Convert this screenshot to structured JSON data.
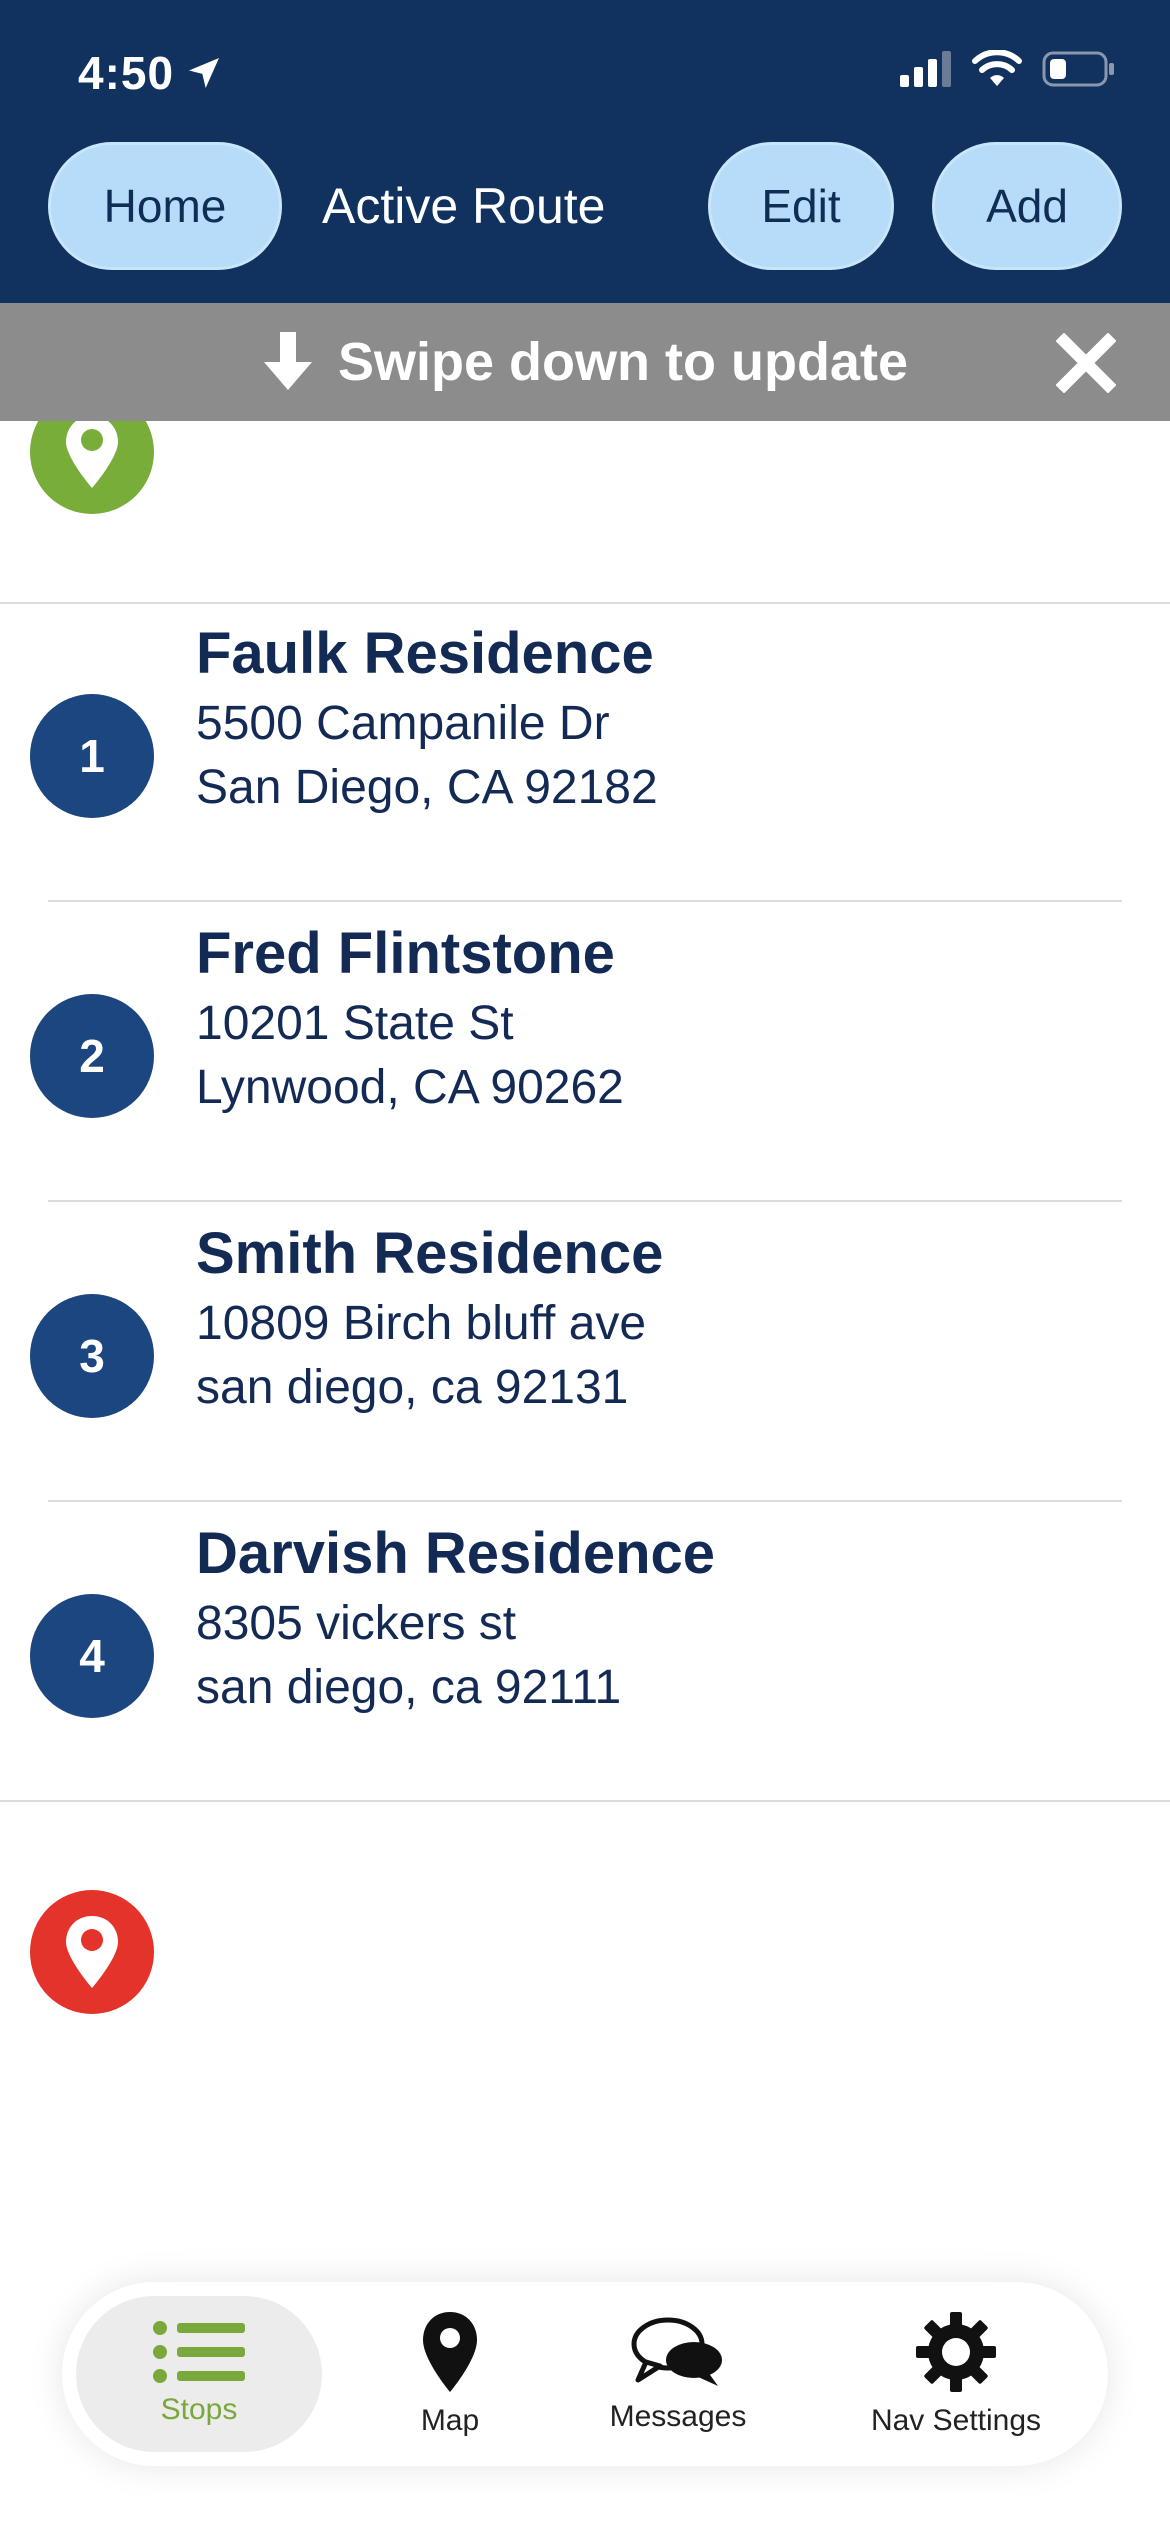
{
  "status_bar": {
    "time": "4:50"
  },
  "header": {
    "home_label": "Home",
    "title": "Active Route",
    "edit_label": "Edit",
    "add_label": "Add"
  },
  "banner": {
    "text": "Swipe down to update"
  },
  "stops": [
    {
      "number": "1",
      "name": "Faulk Residence",
      "line1": "5500 Campanile Dr",
      "line2": "San Diego, CA 92182"
    },
    {
      "number": "2",
      "name": "Fred Flintstone",
      "line1": "10201 State St",
      "line2": "Lynwood, CA 90262"
    },
    {
      "number": "3",
      "name": "Smith Residence",
      "line1": "10809 Birch bluff ave",
      "line2": "san diego, ca 92131"
    },
    {
      "number": "4",
      "name": "Darvish Residence",
      "line1": "8305 vickers st",
      "line2": "san diego, ca 92111"
    }
  ],
  "tabs": [
    {
      "label": "Stops",
      "icon": "list-icon",
      "active": true
    },
    {
      "label": "Map",
      "icon": "map-pin-icon",
      "active": false
    },
    {
      "label": "Messages",
      "icon": "chat-bubbles-icon",
      "active": false
    },
    {
      "label": "Nav Settings",
      "icon": "gear-icon",
      "active": false
    }
  ],
  "colors": {
    "header_bg": "#11325f",
    "pill_bg": "#b6dcf9",
    "banner_bg": "#8c8c8c",
    "start_pin": "#79ad3a",
    "end_pin": "#e4332a",
    "stop_badge": "#1c4680",
    "active_tab": "#7aa83c"
  }
}
